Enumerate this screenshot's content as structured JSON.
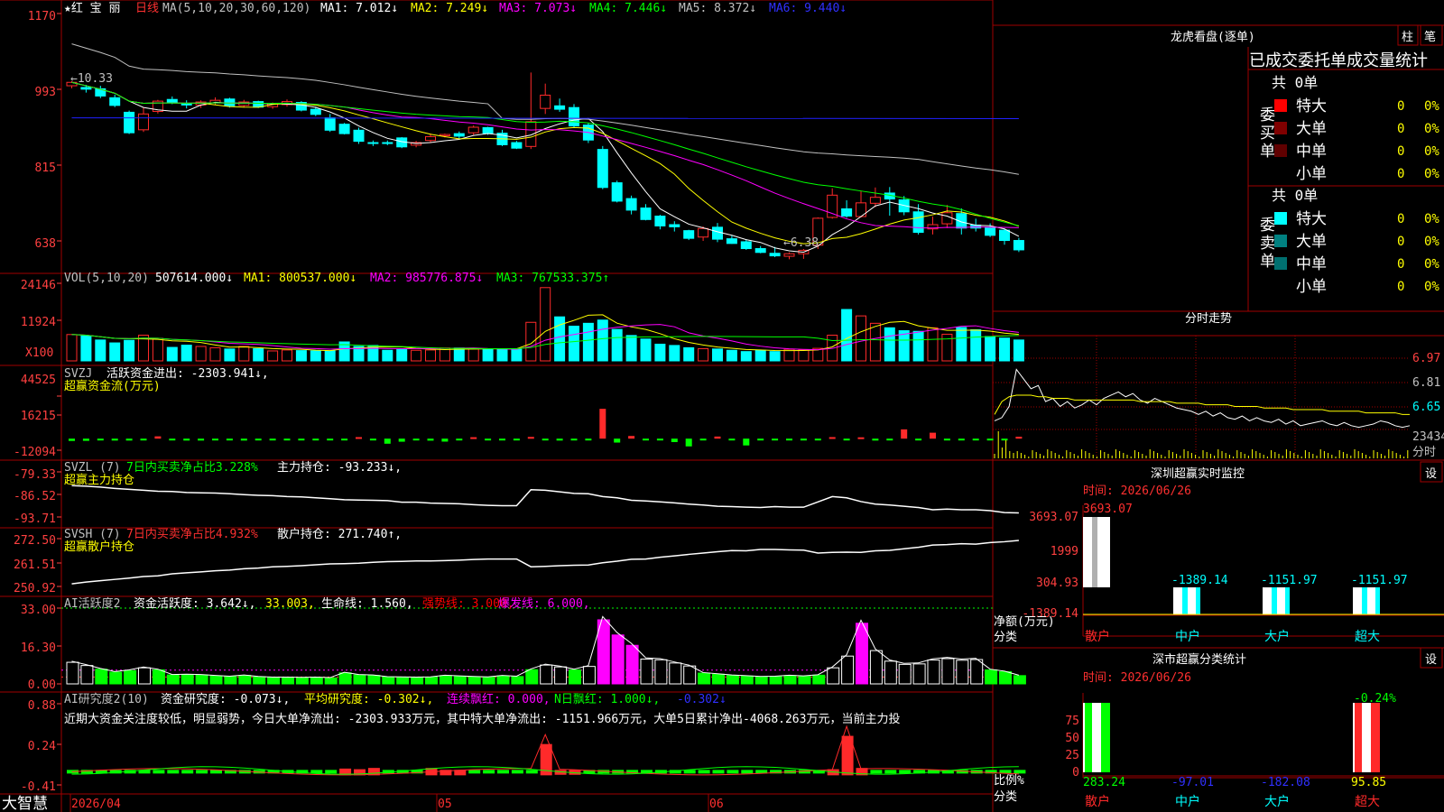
{
  "colors": {
    "up": "#ff2a2a",
    "down": "#00ffff",
    "grid": "#a00000",
    "axis": "#ff4040",
    "ma1": "#ffffff",
    "ma2": "#ffff00",
    "ma3": "#ff00ff",
    "ma4": "#00ff00",
    "ma5": "#c0c0c0",
    "ma6": "#2020ff",
    "green": "#00ff00",
    "magenta": "#ff00ff",
    "yellow": "#ffff00"
  },
  "stock": {
    "name": "★红 宝 丽",
    "period": "日线",
    "ma_label": "MA(5,10,20,30,60,120)",
    "ma1": "MA1: 7.012↓",
    "ma2": "MA2: 7.249↓",
    "ma3": "MA3: 7.073↓",
    "ma4": "MA4: 7.446↓",
    "ma5": "MA5: 8.372↓",
    "ma6": "MA6: 9.440↓",
    "high_note": "←10.33",
    "low_note": "←6.38"
  },
  "price_axis": [
    "1170",
    "993",
    "815",
    "638"
  ],
  "vol": {
    "label": "VOL(5,10,20)",
    "value": "507614.000↓",
    "ma1": "MA1: 800537.000↓",
    "ma2": "MA2: 985776.875↓",
    "ma3": "MA3: 767533.375↑",
    "axis": [
      "24146",
      "11924"
    ],
    "unit": "X100"
  },
  "svzj": {
    "label": "SVZJ",
    "title": "活跃资金进出: -2303.941↓,",
    "subtitle": "超赢资金流(万元)",
    "axis": [
      "44525",
      "16215",
      "-12094"
    ]
  },
  "svzl": {
    "label": "SVZL (7)",
    "t1": "7日内买卖净占比3.228%",
    "t2": "主力持仓: -93.233↓,",
    "subtitle": "超赢主力持仓",
    "axis": [
      "-79.33",
      "-86.52",
      "-93.71"
    ]
  },
  "svsh": {
    "label": "SVSH (7)",
    "t1": "7日内买卖净占比4.932%",
    "t2": "散户持仓: 271.740↑,",
    "subtitle": "超赢散户持仓",
    "axis": [
      "272.50",
      "261.51",
      "250.92"
    ]
  },
  "ai1": {
    "label": "AI活跃度2",
    "t1": "资金活跃度: 3.642↓,",
    "t2": "33.003,",
    "t3": "生命线: 1.560,",
    "t4": "强势线: 3.000,",
    "t5": "爆发线: 6.000,",
    "axis": [
      "33.00",
      "16.30",
      "0.00"
    ]
  },
  "ai2": {
    "label": "AI研究度2(10)",
    "t1": "资金研究度: -0.073↓,",
    "t2": "平均研究度: -0.302↓,",
    "t3": "连续飘红: 0.000,",
    "t4": "N日飘红: 1.000↓,",
    "t5": "-0.302↓",
    "axis": [
      "0.88",
      "0.24",
      "-0.41"
    ],
    "comment": "近期大资金关注度较低，明显弱势，今日大单净流出: -2303.933万元，其中特大单净流出: -1151.966万元，大单5日累计净出-4068.263万元，当前主力投"
  },
  "date_axis": [
    "2026/04",
    "05",
    "06"
  ],
  "brand": "大智慧",
  "chart_data": [
    {
      "type": "candlestick",
      "title": "红宝丽 日线",
      "ylabel": "",
      "y_ticks": [
        1170,
        993,
        815,
        638
      ],
      "candles": [
        [
          1001,
          1009,
          995,
          1012
        ],
        [
          997,
          993,
          985,
          1003
        ],
        [
          994,
          977,
          972,
          1001
        ],
        [
          973,
          955,
          951,
          980
        ],
        [
          939,
          891,
          888,
          943
        ],
        [
          898,
          935,
          893,
          950
        ],
        [
          941,
          965,
          936,
          968
        ],
        [
          969,
          961,
          958,
          976
        ],
        [
          960,
          956,
          948,
          967
        ],
        [
          956,
          963,
          949,
          967
        ],
        [
          961,
          967,
          957,
          974
        ],
        [
          970,
          954,
          950,
          973
        ],
        [
          955,
          963,
          950,
          968
        ],
        [
          964,
          951,
          949,
          966
        ],
        [
          952,
          959,
          947,
          962
        ],
        [
          957,
          964,
          952,
          969
        ],
        [
          962,
          944,
          941,
          965
        ],
        [
          946,
          934,
          930,
          952
        ],
        [
          926,
          897,
          893,
          935
        ],
        [
          911,
          889,
          887,
          914
        ],
        [
          897,
          871,
          865,
          903
        ],
        [
          868,
          866,
          860,
          873
        ],
        [
          868,
          867,
          862,
          873
        ],
        [
          879,
          858,
          855,
          881
        ],
        [
          862,
          868,
          857,
          872
        ],
        [
          873,
          882,
          867,
          889
        ],
        [
          884,
          887,
          880,
          889
        ],
        [
          889,
          883,
          875,
          894
        ],
        [
          891,
          904,
          886,
          908
        ],
        [
          903,
          890,
          886,
          905
        ],
        [
          890,
          863,
          860,
          898
        ],
        [
          868,
          855,
          853,
          872
        ],
        [
          859,
          917,
          853,
          1032
        ],
        [
          948,
          979,
          935,
          1006
        ],
        [
          954,
          946,
          940,
          971
        ],
        [
          950,
          907,
          902,
          958
        ],
        [
          909,
          874,
          867,
          914
        ],
        [
          852,
          763,
          759,
          860
        ],
        [
          774,
          731,
          728,
          779
        ],
        [
          737,
          710,
          700,
          744
        ],
        [
          715,
          688,
          686,
          724
        ],
        [
          696,
          673,
          665,
          699
        ],
        [
          676,
          671,
          660,
          684
        ],
        [
          662,
          644,
          640,
          664
        ],
        [
          647,
          667,
          638,
          672
        ],
        [
          670,
          642,
          635,
          680
        ],
        [
          643,
          632,
          631,
          650
        ],
        [
          636,
          620,
          617,
          642
        ],
        [
          620,
          611,
          609,
          626
        ],
        [
          609,
          603,
          600,
          624
        ],
        [
          602,
          608,
          595,
          611
        ],
        [
          608,
          616,
          596,
          619
        ],
        [
          628,
          691,
          619,
          693
        ],
        [
          693,
          745,
          690,
          761
        ],
        [
          713,
          696,
          692,
          733
        ],
        [
          695,
          727,
          693,
          754
        ],
        [
          726,
          740,
          717,
          763
        ],
        [
          750,
          736,
          697,
          764
        ],
        [
          734,
          706,
          698,
          743
        ],
        [
          706,
          658,
          653,
          724
        ],
        [
          666,
          676,
          653,
          695
        ],
        [
          678,
          704,
          668,
          722
        ],
        [
          702,
          668,
          653,
          714
        ],
        [
          675,
          668,
          660,
          690
        ],
        [
          670,
          651,
          647,
          679
        ],
        [
          663,
          639,
          629,
          667
        ],
        [
          639,
          617,
          612,
          645
        ]
      ]
    },
    {
      "type": "bar",
      "title": "VOL(5,10,20)",
      "ylim": [
        0,
        24146
      ],
      "values": [
        8.2,
        7.8,
        6.5,
        5.6,
        6.4,
        8.0,
        7.0,
        4.2,
        4.9,
        4.5,
        4.1,
        3.7,
        4.5,
        3.8,
        3.1,
        3.4,
        3.2,
        3.1,
        3.1,
        5.9,
        4.5,
        4.8,
        3.3,
        3.5,
        3.3,
        3.4,
        4.0,
        4.0,
        3.7,
        3.6,
        3.7,
        3.8,
        12.0,
        22.8,
        13.7,
        10.8,
        11.7,
        12.7,
        9.8,
        7.9,
        6.8,
        5.2,
        4.8,
        4.1,
        3.8,
        3.7,
        3.3,
        2.9,
        3.3,
        2.9,
        3.6,
        3.4,
        3.9,
        8.0,
        16.0,
        14.0,
        11.7,
        10.3,
        9.4,
        9.2,
        10.3,
        8.3,
        10.4,
        9.7,
        7.6,
        7.1,
        6.5
      ]
    },
    {
      "type": "bar",
      "title": "超赢资金流(万元)",
      "ylim": [
        -12094,
        44525
      ],
      "values": [
        -2400,
        -2300,
        -1900,
        -2000,
        -2000,
        -1900,
        2400,
        -1600,
        -2000,
        -2000,
        -1800,
        -1500,
        -2000,
        -1800,
        -1500,
        -1500,
        -1500,
        -1800,
        -1700,
        -1500,
        1600,
        -1800,
        -5300,
        -3200,
        -1700,
        -2100,
        -3100,
        -1900,
        1500,
        -1700,
        -1900,
        -1800,
        1800,
        -1400,
        -2000,
        -1900,
        -1900,
        31200,
        -4100,
        2800,
        -1900,
        -1900,
        -3600,
        -8100,
        -1700,
        2200,
        -1800,
        -7100,
        -1900,
        -1900,
        -1900,
        -1900,
        -1800,
        1600,
        -1500,
        1400,
        -2000,
        -1700,
        9700,
        -1500,
        6200,
        -1900,
        -1900,
        -1700,
        -1900,
        -1800,
        2000
      ]
    },
    {
      "type": "line",
      "title": "超赢主力持仓",
      "ylim": [
        -93.71,
        -79.33
      ],
      "values": [
        -83.7,
        -83.9,
        -84.2,
        -84.6,
        -84.9,
        -85.2,
        -85.5,
        -85.6,
        -85.9,
        -86.0,
        -86.1,
        -86.3,
        -86.6,
        -86.8,
        -86.9,
        -87.2,
        -87.3,
        -87.6,
        -87.9,
        -88.2,
        -88.3,
        -88.4,
        -88.5,
        -89.0,
        -89.0,
        -89.3,
        -89.4,
        -89.5,
        -89.8,
        -90.0,
        -90.1,
        -90.1,
        -85.0,
        -85.2,
        -85.7,
        -86.2,
        -86.3,
        -87.2,
        -87.6,
        -88.4,
        -88.6,
        -88.9,
        -89.2,
        -89.6,
        -89.9,
        -90.3,
        -90.4,
        -90.6,
        -90.7,
        -90.4,
        -90.6,
        -90.6,
        -88.9,
        -87.2,
        -87.6,
        -88.8,
        -89.6,
        -89.9,
        -90.3,
        -90.7,
        -91.4,
        -91.2,
        -91.4,
        -91.4,
        -91.7,
        -92.3,
        -92.4
      ]
    },
    {
      "type": "line",
      "title": "超赢散户持仓",
      "ylim": [
        250.92,
        272.5
      ],
      "values": [
        252.1,
        252.9,
        253.5,
        254.1,
        254.7,
        255.4,
        255.7,
        256.6,
        257.1,
        257.5,
        258.0,
        258.3,
        258.9,
        259.2,
        259.8,
        260.0,
        260.3,
        260.7,
        261.1,
        261.2,
        261.4,
        261.8,
        262.1,
        262.2,
        262.4,
        262.4,
        262.6,
        262.8,
        263.1,
        263.3,
        263.3,
        263.3,
        259.8,
        260.0,
        260.3,
        260.5,
        260.6,
        261.6,
        262.3,
        263.2,
        263.3,
        264.1,
        264.7,
        265.4,
        266.0,
        266.6,
        267.1,
        267.0,
        267.6,
        267.6,
        267.4,
        267.3,
        266.0,
        266.3,
        266.4,
        266.3,
        267.0,
        267.2,
        267.9,
        268.6,
        269.6,
        269.8,
        270.2,
        270.0,
        270.7,
        271.1,
        271.7
      ]
    },
    {
      "type": "bar",
      "title": "AI活跃度2",
      "ylim": [
        0,
        33
      ],
      "values": [
        9.4,
        8.0,
        6.4,
        5.1,
        5.8,
        7.0,
        6.1,
        3.9,
        4.0,
        3.9,
        3.5,
        3.2,
        3.7,
        3.1,
        2.8,
        2.8,
        2.7,
        2.8,
        2.6,
        4.8,
        3.9,
        3.7,
        3.0,
        2.9,
        2.8,
        2.9,
        3.6,
        3.3,
        3.1,
        2.9,
        3.5,
        3.2,
        6.2,
        8.2,
        7.4,
        6.1,
        7.6,
        27.9,
        21.3,
        16.8,
        10.8,
        10.5,
        9.1,
        7.8,
        4.7,
        4.2,
        3.7,
        3.4,
        3.1,
        3.2,
        3.6,
        3.3,
        3.8,
        7.0,
        12.1,
        26.4,
        14.5,
        9.9,
        8.5,
        8.7,
        10.4,
        11.0,
        10.3,
        10.6,
        6.1,
        5.3,
        3.6
      ]
    },
    {
      "type": "bar",
      "title": "AI研究度2(10)",
      "ylim": [
        -0.41,
        0.88
      ],
      "values": [
        -0.2,
        -0.2,
        -0.2,
        -0.2,
        -0.2,
        -0.2,
        -0.2,
        -0.2,
        -0.2,
        -0.2,
        -0.2,
        -0.2,
        -0.2,
        -0.2,
        -0.2,
        -0.2,
        -0.2,
        -0.2,
        -0.2,
        -0.15,
        -0.16,
        -0.14,
        -0.2,
        -0.2,
        -0.2,
        -0.14,
        -0.17,
        -0.17,
        -0.2,
        -0.2,
        -0.2,
        -0.2,
        -0.2,
        0.24,
        -0.18,
        -0.18,
        -0.2,
        -0.2,
        -0.2,
        -0.2,
        -0.2,
        -0.2,
        -0.2,
        -0.2,
        -0.2,
        -0.2,
        -0.2,
        -0.2,
        -0.2,
        -0.2,
        -0.2,
        -0.2,
        -0.2,
        -0.16,
        0.37,
        -0.14,
        -0.2,
        -0.2,
        -0.2,
        -0.2,
        -0.2,
        -0.2,
        -0.2,
        -0.2,
        -0.2,
        -0.2,
        -0.2
      ]
    }
  ],
  "lhb": {
    "title": "龙虎看盘(逐单)",
    "btn1": "柱",
    "btn2": "笔",
    "header": "已成交委托单成交量统计",
    "buy_side": "委买单",
    "sell_side": "委卖单",
    "buy_total": "共 0单",
    "sell_total": "共 0单",
    "rows": [
      {
        "name": "特大",
        "count": "0",
        "pct": "0%"
      },
      {
        "name": "大单",
        "count": "0",
        "pct": "0%"
      },
      {
        "name": "中单",
        "count": "0",
        "pct": "0%"
      },
      {
        "name": "小单",
        "count": "0",
        "pct": "0%"
      }
    ],
    "colors_buy": [
      "#ff0000",
      "#800000",
      "#600000",
      "#000000"
    ],
    "colors_sell": [
      "#00ffff",
      "#008080",
      "#007070",
      "#000000"
    ]
  },
  "intraday": {
    "title": "分时走势",
    "axis": [
      "6.97",
      "6.81",
      "6.65",
      "23434",
      "分时"
    ],
    "price": [
      6.58,
      6.6,
      6.67,
      6.9,
      6.84,
      6.78,
      6.8,
      6.7,
      6.72,
      6.67,
      6.7,
      6.66,
      6.68,
      6.71,
      6.68,
      6.72,
      6.74,
      6.76,
      6.73,
      6.75,
      6.71,
      6.69,
      6.72,
      6.7,
      6.68,
      6.66,
      6.65,
      6.64,
      6.62,
      6.64,
      6.61,
      6.63,
      6.6,
      6.59,
      6.61,
      6.58,
      6.6,
      6.58,
      6.57,
      6.59,
      6.56,
      6.58,
      6.55,
      6.56,
      6.57,
      6.58,
      6.56,
      6.55,
      6.57,
      6.55,
      6.54,
      6.55,
      6.56,
      6.58,
      6.57,
      6.55,
      6.54,
      6.55
    ],
    "avg": [
      6.62,
      6.7,
      6.73,
      6.74,
      6.74,
      6.74,
      6.73,
      6.73,
      6.72,
      6.72,
      6.72,
      6.71,
      6.71,
      6.71,
      6.71,
      6.71,
      6.71,
      6.71,
      6.71,
      6.71,
      6.7,
      6.7,
      6.7,
      6.7,
      6.7,
      6.69,
      6.69,
      6.69,
      6.69,
      6.68,
      6.68,
      6.68,
      6.68,
      6.67,
      6.67,
      6.67,
      6.67,
      6.66,
      6.66,
      6.66,
      6.66,
      6.65,
      6.65,
      6.65,
      6.65,
      6.65,
      6.64,
      6.64,
      6.64,
      6.64,
      6.64,
      6.63,
      6.63,
      6.63,
      6.63,
      6.63,
      6.62,
      6.62
    ]
  },
  "sz_monitor": {
    "title": "深圳超赢实时监控",
    "btn": "设",
    "time": "时间: 2026/06/26",
    "top_value": "3693.07",
    "axis": [
      "3693.07",
      "1999",
      "304.93",
      "-1389.14"
    ],
    "ylabel": "净额(万元)",
    "xlabel": "分类",
    "cats": [
      "散户",
      "中户",
      "大户",
      "超大"
    ],
    "values": [
      3693.07,
      -1389.14,
      -1151.97,
      -1151.97
    ],
    "labels": [
      "",
      "-1389.14",
      "-1151.97",
      "-1151.97"
    ]
  },
  "sz_class": {
    "title": "深市超赢分类统计",
    "btn": "设",
    "time": "时间: 2026/06/26",
    "top_value": "-0.24%",
    "axis": [
      "75",
      "50",
      "25",
      "0"
    ],
    "ylabel": "比例%",
    "xlabel": "分类",
    "cats": [
      "散户",
      "中户",
      "大户",
      "超大"
    ],
    "values": [
      283.24,
      -97.01,
      -182.08,
      95.85
    ],
    "labels": [
      "283.24",
      "-97.01",
      "-182.08",
      "95.85"
    ]
  }
}
